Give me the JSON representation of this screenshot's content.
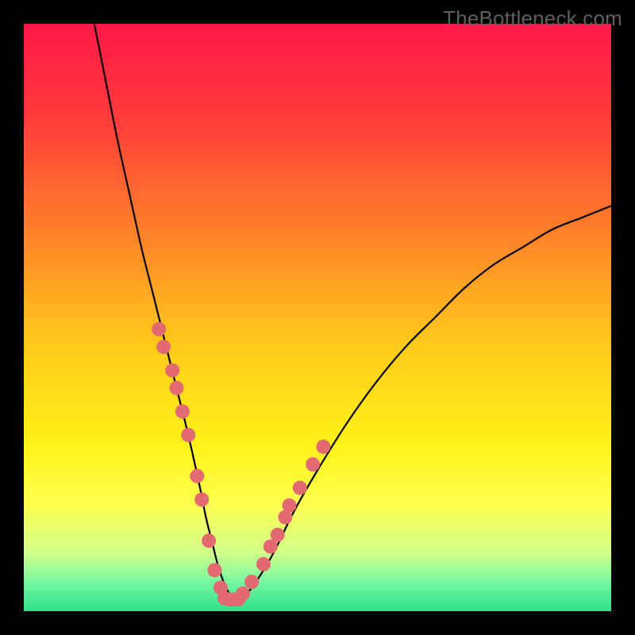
{
  "attribution": "TheBottleneck.com",
  "chart_data": {
    "type": "line",
    "title": "",
    "xlabel": "",
    "ylabel": "",
    "xlim": [
      0,
      100
    ],
    "ylim": [
      0,
      100
    ],
    "series": [
      {
        "name": "curve",
        "x": [
          12,
          14,
          16,
          18,
          20,
          22,
          24,
          26,
          28,
          30,
          31,
          32,
          33,
          34,
          35,
          36,
          38,
          42,
          46,
          50,
          55,
          60,
          65,
          70,
          75,
          80,
          85,
          90,
          95,
          100
        ],
        "y": [
          100,
          90,
          80,
          71,
          62,
          54,
          46,
          38,
          30,
          21,
          16,
          12,
          8,
          5,
          3,
          2,
          3,
          9,
          17,
          24,
          32,
          39,
          45,
          50,
          55,
          59,
          62,
          65,
          67,
          69
        ]
      }
    ],
    "dots_left": [
      {
        "x": 23.0,
        "y": 48
      },
      {
        "x": 23.8,
        "y": 45
      },
      {
        "x": 25.3,
        "y": 41
      },
      {
        "x": 26.0,
        "y": 38
      },
      {
        "x": 27.0,
        "y": 34
      },
      {
        "x": 28.0,
        "y": 30
      },
      {
        "x": 29.5,
        "y": 23
      },
      {
        "x": 30.3,
        "y": 19
      },
      {
        "x": 31.5,
        "y": 12
      },
      {
        "x": 32.5,
        "y": 7
      },
      {
        "x": 33.5,
        "y": 4
      }
    ],
    "dots_right": [
      {
        "x": 37.3,
        "y": 3
      },
      {
        "x": 38.8,
        "y": 5
      },
      {
        "x": 40.8,
        "y": 8
      },
      {
        "x": 42.0,
        "y": 11
      },
      {
        "x": 43.2,
        "y": 13
      },
      {
        "x": 44.5,
        "y": 16
      },
      {
        "x": 45.2,
        "y": 18
      },
      {
        "x": 47.0,
        "y": 21
      },
      {
        "x": 49.2,
        "y": 25
      },
      {
        "x": 51.0,
        "y": 28
      }
    ],
    "dots_bottom": [
      {
        "x": 34.2,
        "y": 2.2
      },
      {
        "x": 35.0,
        "y": 2.0
      },
      {
        "x": 35.8,
        "y": 2.0
      },
      {
        "x": 36.5,
        "y": 2.0
      }
    ],
    "gradient_stops": [
      {
        "offset": 0.0,
        "color": "#ff1a49"
      },
      {
        "offset": 0.15,
        "color": "#ff383b"
      },
      {
        "offset": 0.35,
        "color": "#ff7f2a"
      },
      {
        "offset": 0.55,
        "color": "#ffcb19"
      },
      {
        "offset": 0.72,
        "color": "#fff319"
      },
      {
        "offset": 0.82,
        "color": "#fcff4f"
      },
      {
        "offset": 0.9,
        "color": "#d2ff8a"
      },
      {
        "offset": 0.95,
        "color": "#77f7a0"
      },
      {
        "offset": 1.0,
        "color": "#2fe089"
      }
    ],
    "dot_color": "#e46a72",
    "curve_color": "#000000"
  }
}
